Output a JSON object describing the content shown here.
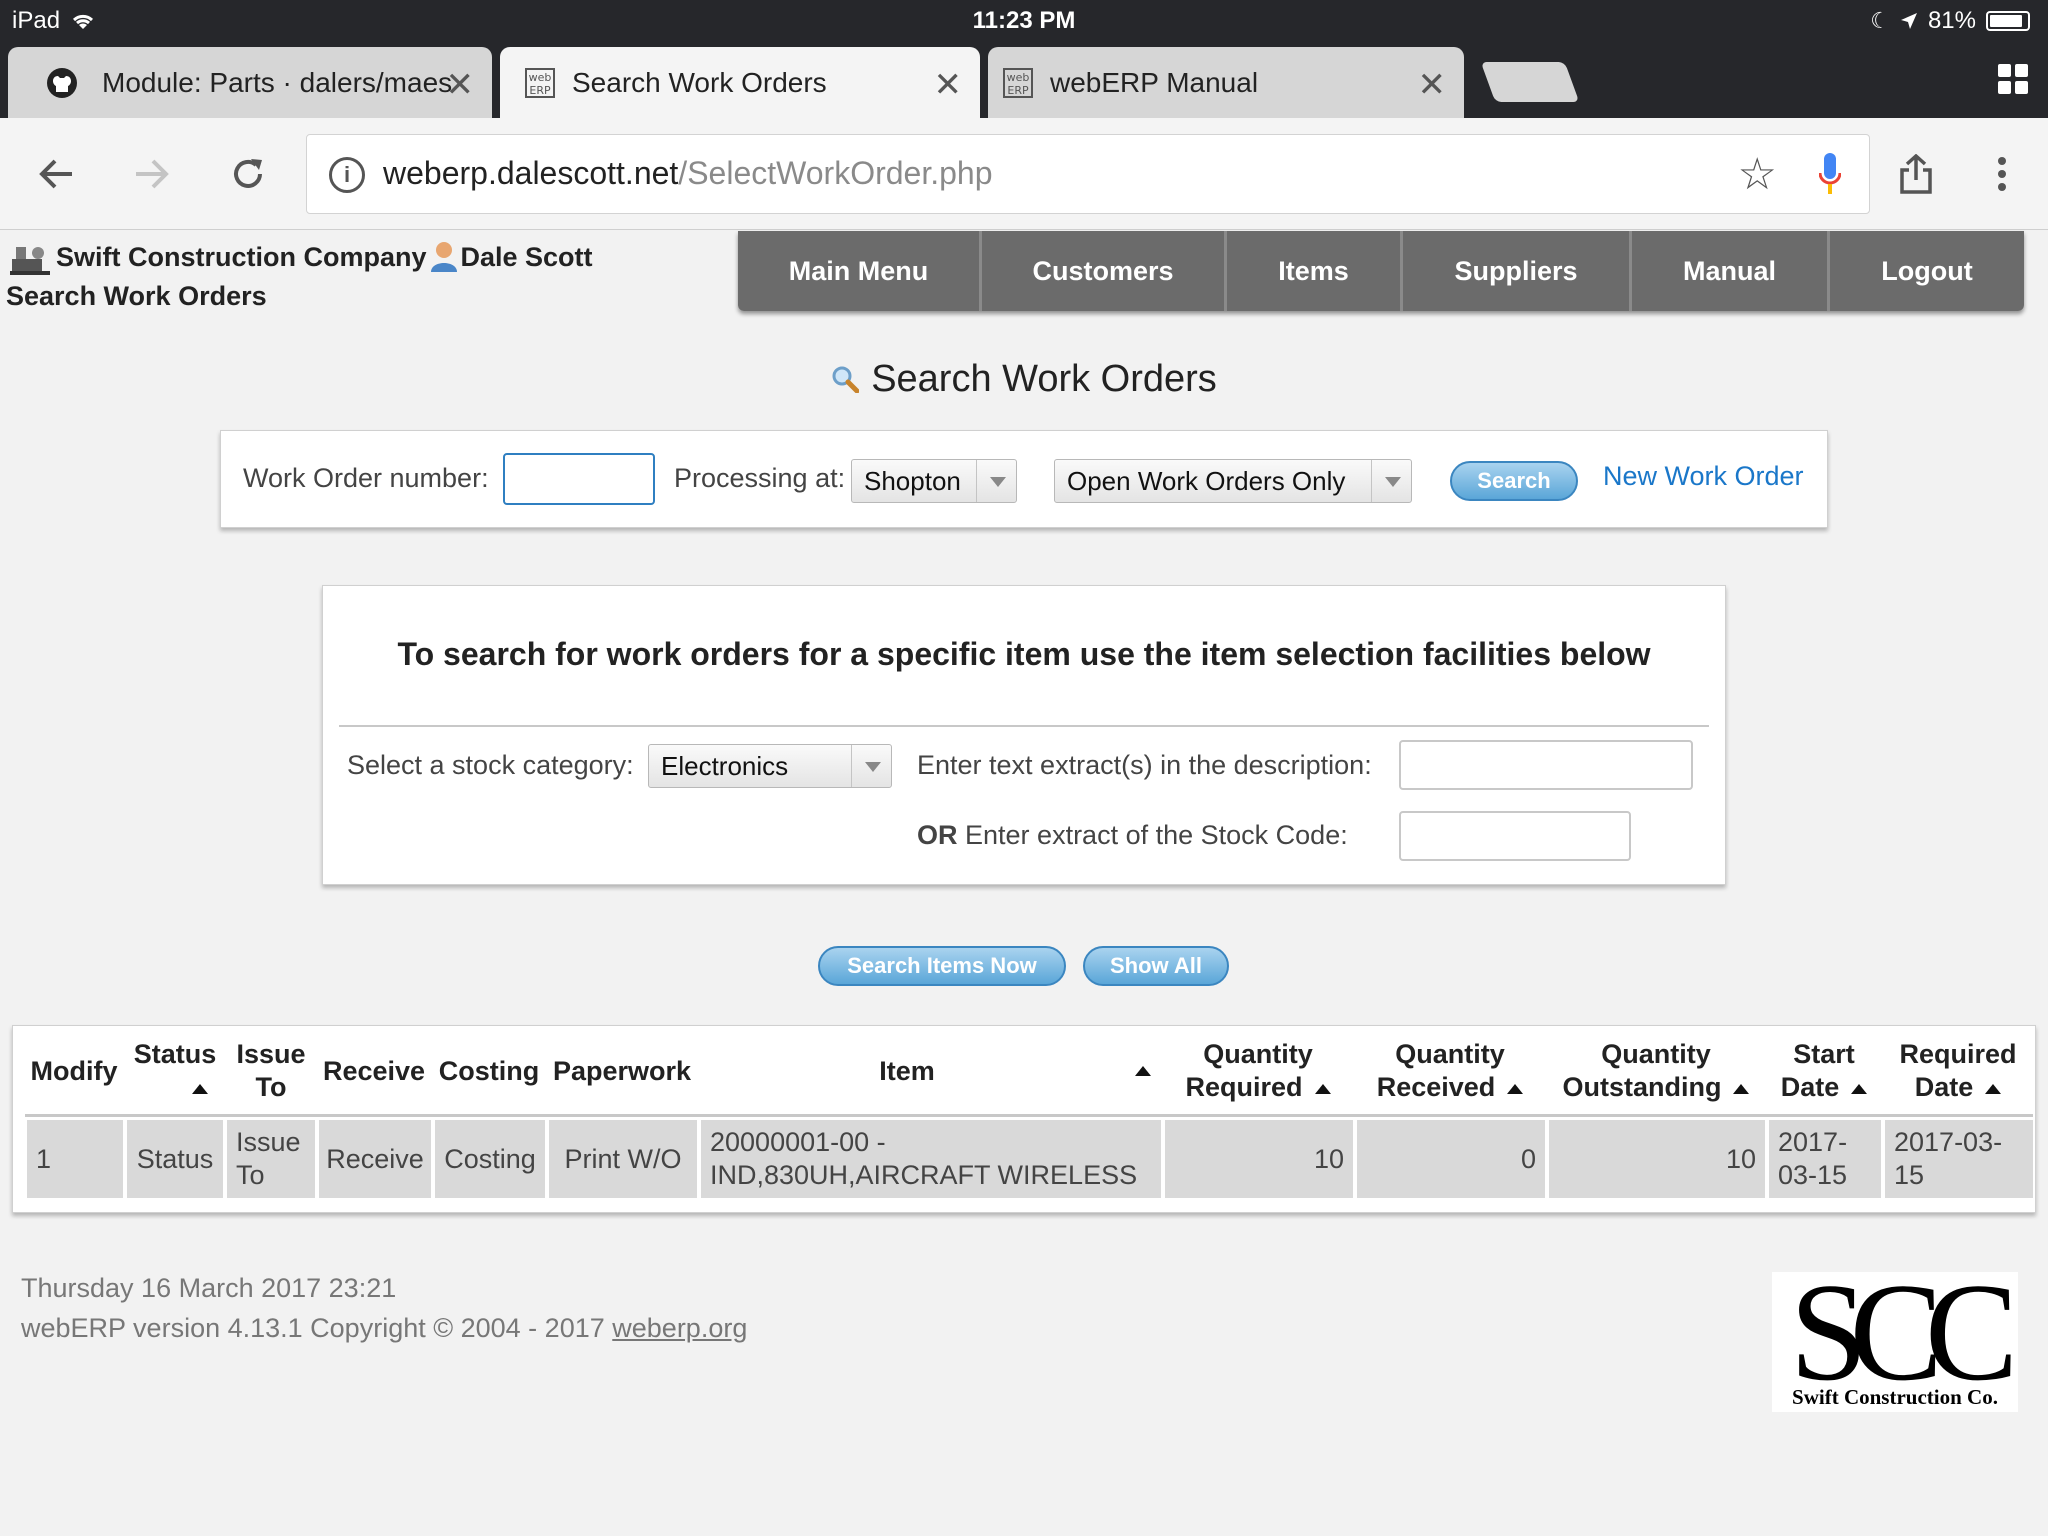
{
  "statusbar": {
    "device": "iPad",
    "time": "11:23 PM",
    "battery": "81%"
  },
  "tabs": [
    {
      "label": "Module: Parts · dalers/maes",
      "icon": "github-icon"
    },
    {
      "label": "Search Work Orders",
      "icon": "weberp-icon"
    },
    {
      "label": "webERP Manual",
      "icon": "weberp-icon"
    }
  ],
  "address": {
    "host": "weberp.dalescott.net",
    "path": "/SelectWorkOrder.php"
  },
  "header": {
    "company": "Swift Construction Company",
    "user": "Dale Scott",
    "page": "Search Work Orders"
  },
  "nav": [
    "Main Menu",
    "Customers",
    "Items",
    "Suppliers",
    "Manual",
    "Logout"
  ],
  "title": "Search Work Orders",
  "search": {
    "wo_label": "Work Order number:",
    "wo_value": "",
    "processing_label": "Processing at:",
    "location": "Shopton",
    "status_filter": "Open Work Orders Only",
    "search_button": "Search",
    "new_link": "New Work Order"
  },
  "item_panel": {
    "heading": "To search for work orders for a specific item use the item selection facilities below",
    "category_label": "Select a stock category:",
    "category": "Electronics",
    "desc_label": "Enter text extract(s) in the description:",
    "desc_value": "",
    "or": "OR",
    "code_label": "Enter extract of the Stock Code:",
    "code_value": "",
    "search_items_button": "Search Items Now",
    "show_all_button": "Show All"
  },
  "table": {
    "headers": {
      "modify": "Modify",
      "status": "Status",
      "issue_to": [
        "Issue",
        "To"
      ],
      "receive": "Receive",
      "costing": "Costing",
      "paperwork": "Paperwork",
      "item": "Item",
      "qty_required": [
        "Quantity",
        "Required"
      ],
      "qty_received": [
        "Quantity",
        "Received"
      ],
      "qty_outstanding": [
        "Quantity",
        "Outstanding"
      ],
      "start_date": [
        "Start",
        "Date"
      ],
      "required_date": [
        "Required",
        "Date"
      ]
    },
    "rows": [
      {
        "modify": "1",
        "status": "Status",
        "issue_to": [
          "Issue",
          "To"
        ],
        "receive": "Receive",
        "costing": "Costing",
        "paperwork": "Print W/O",
        "item": [
          "20000001-00 -",
          "IND,830UH,AIRCRAFT WIRELESS"
        ],
        "qty_required": "10",
        "qty_received": "0",
        "qty_outstanding": "10",
        "start_date": [
          "2017-",
          "03-15"
        ],
        "required_date": [
          "2017-03-",
          "15"
        ]
      }
    ]
  },
  "footer": {
    "datetime": "Thursday 16 March 2017 23:21",
    "version": "webERP version 4.13.1 Copyright © 2004 - 2017",
    "site_link": "weberp.org"
  },
  "logo": {
    "big": "SCC",
    "small": "Swift Construction Co."
  }
}
